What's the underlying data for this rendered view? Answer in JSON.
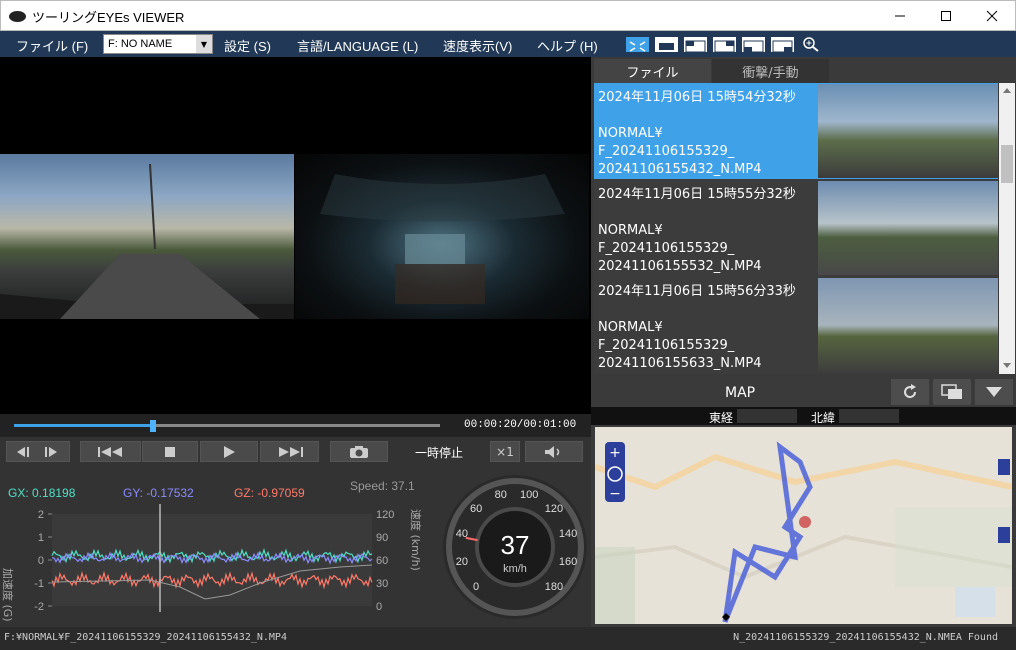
{
  "window": {
    "title": "ツーリングEYEs VIEWER"
  },
  "menu": {
    "file": "ファイル (F)",
    "drive": "F: NO NAME",
    "settings": "設定 (S)",
    "language": "言語/LANGUAGE (L)",
    "speed_display": "速度表示(V)",
    "help": "ヘルプ (H)"
  },
  "player": {
    "time": "00:00:20/00:01:00",
    "progress": 0.333,
    "state_label": "一時停止",
    "speed_rate": "×1"
  },
  "sensors": {
    "gx": "GX: 0.18198",
    "gy": "GY: -0.17532",
    "gz": "GZ: -0.97059",
    "speed": "Speed: 37.1",
    "accel_axis_label": "加速度 (G)",
    "speed_axis_label": "速度 (km/h)",
    "left_ticks": [
      "2",
      "1",
      "0",
      "-1",
      "-2"
    ],
    "right_ticks": [
      "120",
      "90",
      "60",
      "30",
      "0"
    ],
    "colors": {
      "gx": "#4fe0c6",
      "gy": "#8a8cff",
      "gz": "#ff7a6a"
    }
  },
  "gauge": {
    "value": "37",
    "unit": "km/h",
    "ticks": [
      "0",
      "20",
      "40",
      "60",
      "80",
      "100",
      "120",
      "140",
      "160",
      "180"
    ],
    "speed_value": 37
  },
  "tabs": {
    "files": "ファイル",
    "impact": "衝撃/手動"
  },
  "files": [
    {
      "datetime": "2024年11月06日 15時54分32秒",
      "path": "NORMAL¥\nF_20241106155329_\n20241106155432_N.MP4",
      "selected": true
    },
    {
      "datetime": "2024年11月06日 15時55分32秒",
      "path": "NORMAL¥\nF_20241106155329_\n20241106155532_N.MP4",
      "selected": false
    },
    {
      "datetime": "2024年11月06日 15時56分33秒",
      "path": "NORMAL¥\nF_20241106155329_\n20241106155633_N.MP4",
      "selected": false
    }
  ],
  "map": {
    "title": "MAP",
    "east_label": "東経",
    "north_label": "北緯"
  },
  "status": {
    "left": "F:¥NORMAL¥F_20241106155329_20241106155432_N.MP4",
    "right": "N_20241106155329_20241106155432_N.NMEA Found"
  },
  "accent": "#3fa1e8"
}
